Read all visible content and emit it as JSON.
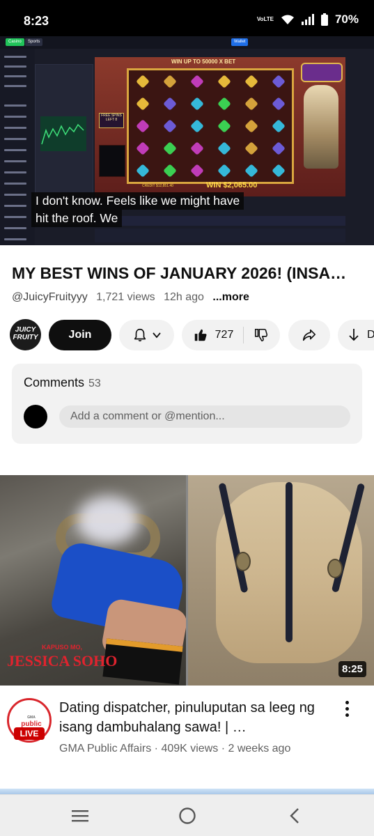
{
  "status_bar": {
    "time": "8:23",
    "network_label": "VoLTE",
    "battery": "70%"
  },
  "player": {
    "captions": [
      "I don't know. Feels like we might have",
      "hit the roof. We"
    ],
    "game": {
      "banner": "WIN UP TO 50000 X BET",
      "win_text": "WIN $2,065.00",
      "credit_text": "CREDIT $12,851.40",
      "free_spins_text": "FREE SPINS LEFT 8",
      "tab_casino": "Casino",
      "tab_sports": "Sports",
      "wallet_label": "Wallet",
      "accent_green": "#21c35a",
      "accent_blue": "#1f6fe8"
    }
  },
  "video": {
    "title": "MY BEST WINS OF JANUARY 2026! (INSA…",
    "channel_handle": "@JuicyFruityyy",
    "views": "1,721 views",
    "age": "12h ago",
    "more_label": "...more"
  },
  "actions": {
    "avatar_text": "JUICY FRUITY",
    "join_label": "Join",
    "like_count": "727",
    "download_label": "D"
  },
  "comments": {
    "heading": "Comments",
    "count": "53",
    "input_placeholder": "Add a comment or @mention..."
  },
  "recommended": {
    "thumbnail": {
      "show_logo": "JESSICA SOHO",
      "show_logo_small": "KAPUSO MO,",
      "duration": "8:25"
    },
    "channel_avatar_text": "public affairs",
    "channel_avatar_small": "GMA",
    "live_badge": "LIVE",
    "title": "Dating dispatcher, pinuluputan sa leeg ng isang dambuhalang sawa! | …",
    "channel": "GMA Public Affairs",
    "views": "409K views",
    "age": "2 weeks ago",
    "separator": "·"
  },
  "icons": {
    "bell": "bell-icon",
    "chevron": "chevron-down-icon",
    "like": "thumb-up-icon",
    "dislike": "thumb-down-icon",
    "share": "share-icon",
    "download": "download-icon",
    "menu": "kebab-menu-icon",
    "nav_recents": "recents-icon",
    "nav_home": "home-icon",
    "nav_back": "back-icon"
  },
  "colors": {
    "live_red": "#cc0000",
    "gma_red": "#d9262c",
    "chip_bg": "#f2f2f2"
  }
}
